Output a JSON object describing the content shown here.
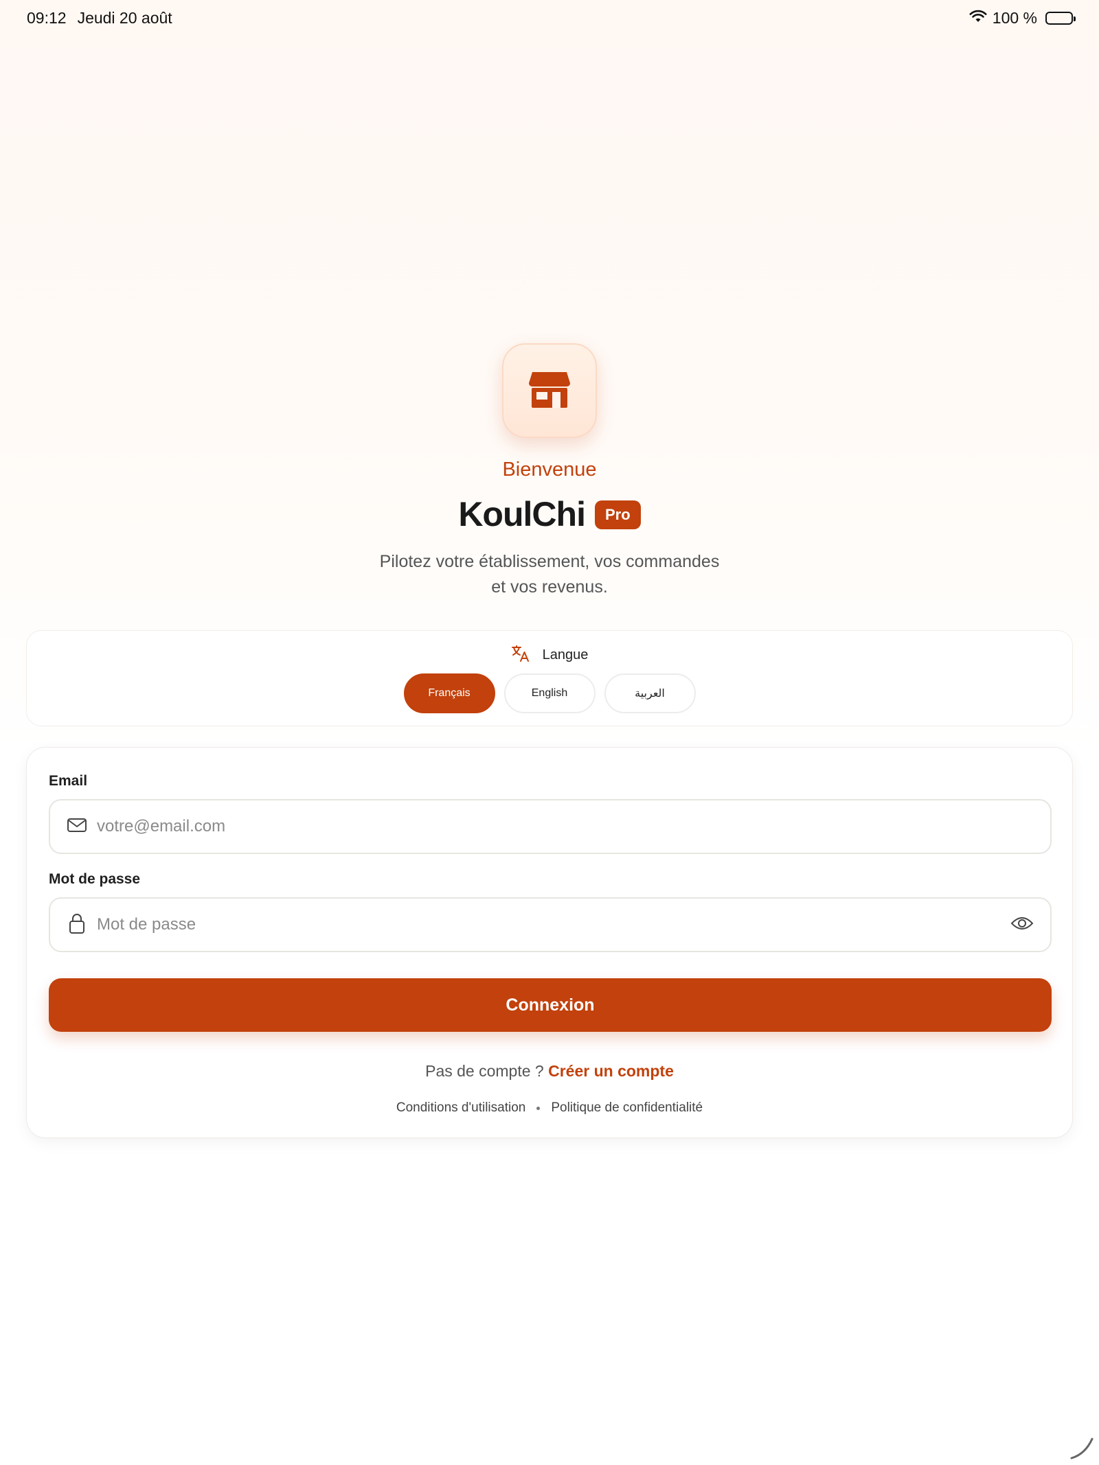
{
  "status_bar": {
    "time": "09:12",
    "date": "Jeudi 20 août",
    "battery": "100 %"
  },
  "hero": {
    "icon": "storefront-icon",
    "welcome": "Bienvenue",
    "brand": "KoulChi",
    "badge": "Pro",
    "tagline": "Pilotez votre établissement, vos commandes et vos revenus."
  },
  "language": {
    "icon": "translate-icon",
    "title": "Langue",
    "options": [
      "Français",
      "English",
      "العربية"
    ],
    "selected": "Français"
  },
  "form": {
    "email_label": "Email",
    "email_placeholder": "votre@email.com",
    "email_icon": "mail-icon",
    "password_label": "Mot de passe",
    "password_placeholder": "Mot de passe",
    "password_icon": "lock-icon",
    "toggle_icon": "eye-icon",
    "submit": "Connexion",
    "no_account": "Pas de compte ?",
    "create_account": "Créer un compte",
    "terms": "Conditions d'utilisation",
    "privacy": "Politique de confidentialité"
  },
  "colors": {
    "accent": "#c2410c",
    "background_top": "#fff8f3",
    "text": "#1f1f1f"
  }
}
